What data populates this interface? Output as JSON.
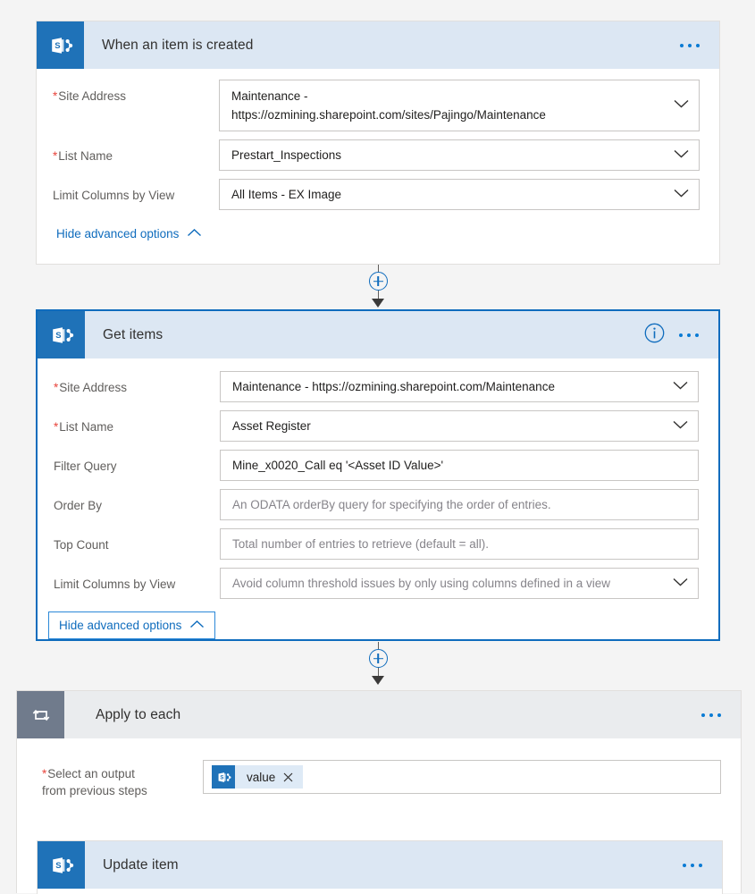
{
  "theme": {
    "page_background": "#f4f4f4",
    "header_blue": "#dce7f3",
    "header_grey": "#eaecee",
    "sharepoint_blue": "#1f72b8",
    "loop_grey": "#707b8c",
    "accent_blue": "#0f6cbd",
    "required_red": "#e8443c",
    "token_blue": "#deeaf6"
  },
  "steps": [
    {
      "id": "when-an-item-is-created",
      "title": "When an item is created",
      "icon": "sharepoint-icon",
      "selected": false,
      "has_info_icon": false,
      "fields": [
        {
          "label": "Site Address",
          "required": true,
          "value": "Maintenance -\nhttps://ozmining.sharepoint.com/sites/Pajingo/Maintenance",
          "placeholder": "",
          "is_placeholder": false,
          "dropdown": true,
          "two_line": true
        },
        {
          "label": "List Name",
          "required": true,
          "value": "Prestart_Inspections",
          "placeholder": "",
          "is_placeholder": false,
          "dropdown": true,
          "two_line": false
        },
        {
          "label": "Limit Columns by View",
          "required": false,
          "value": "All Items - EX Image",
          "placeholder": "",
          "is_placeholder": false,
          "dropdown": true,
          "two_line": false
        }
      ],
      "advanced_link": {
        "label": "Hide advanced options",
        "chevron": "chevron-up-icon",
        "focused": false
      }
    },
    {
      "id": "get-items",
      "title": "Get items",
      "icon": "sharepoint-icon",
      "selected": true,
      "has_info_icon": true,
      "fields": [
        {
          "label": "Site Address",
          "required": true,
          "value": "Maintenance - https://ozmining.sharepoint.com/Maintenance",
          "placeholder": "",
          "is_placeholder": false,
          "dropdown": true,
          "two_line": false
        },
        {
          "label": "List Name",
          "required": true,
          "value": "Asset Register",
          "placeholder": "",
          "is_placeholder": false,
          "dropdown": true,
          "two_line": false
        },
        {
          "label": "Filter Query",
          "required": false,
          "value": "Mine_x0020_Call eq '<Asset ID Value>'",
          "placeholder": "",
          "is_placeholder": false,
          "dropdown": false,
          "two_line": false
        },
        {
          "label": "Order By",
          "required": false,
          "value": "",
          "placeholder": "An ODATA orderBy query for specifying the order of entries.",
          "is_placeholder": true,
          "dropdown": false,
          "two_line": false
        },
        {
          "label": "Top Count",
          "required": false,
          "value": "",
          "placeholder": "Total number of entries to retrieve (default = all).",
          "is_placeholder": true,
          "dropdown": false,
          "two_line": false
        },
        {
          "label": "Limit Columns by View",
          "required": false,
          "value": "",
          "placeholder": "Avoid column threshold issues by only using columns defined in a view",
          "is_placeholder": true,
          "dropdown": true,
          "two_line": false
        }
      ],
      "advanced_link": {
        "label": "Hide advanced options",
        "chevron": "chevron-up-icon",
        "focused": true
      }
    },
    {
      "id": "apply-to-each",
      "title": "Apply to each",
      "icon": "loop-icon",
      "selected": false,
      "has_info_icon": false,
      "output_field": {
        "label_line1": "Select an output",
        "label_line2": "from previous steps",
        "required": true,
        "token": {
          "label": "value",
          "icon": "sharepoint-icon",
          "remove_icon": "close-icon"
        }
      },
      "nested_step": {
        "id": "update-item",
        "title": "Update item",
        "icon": "sharepoint-icon"
      }
    }
  ],
  "connectors": [
    {
      "id": "connector-1",
      "add_label": "+"
    },
    {
      "id": "connector-2",
      "add_label": "+"
    }
  ]
}
